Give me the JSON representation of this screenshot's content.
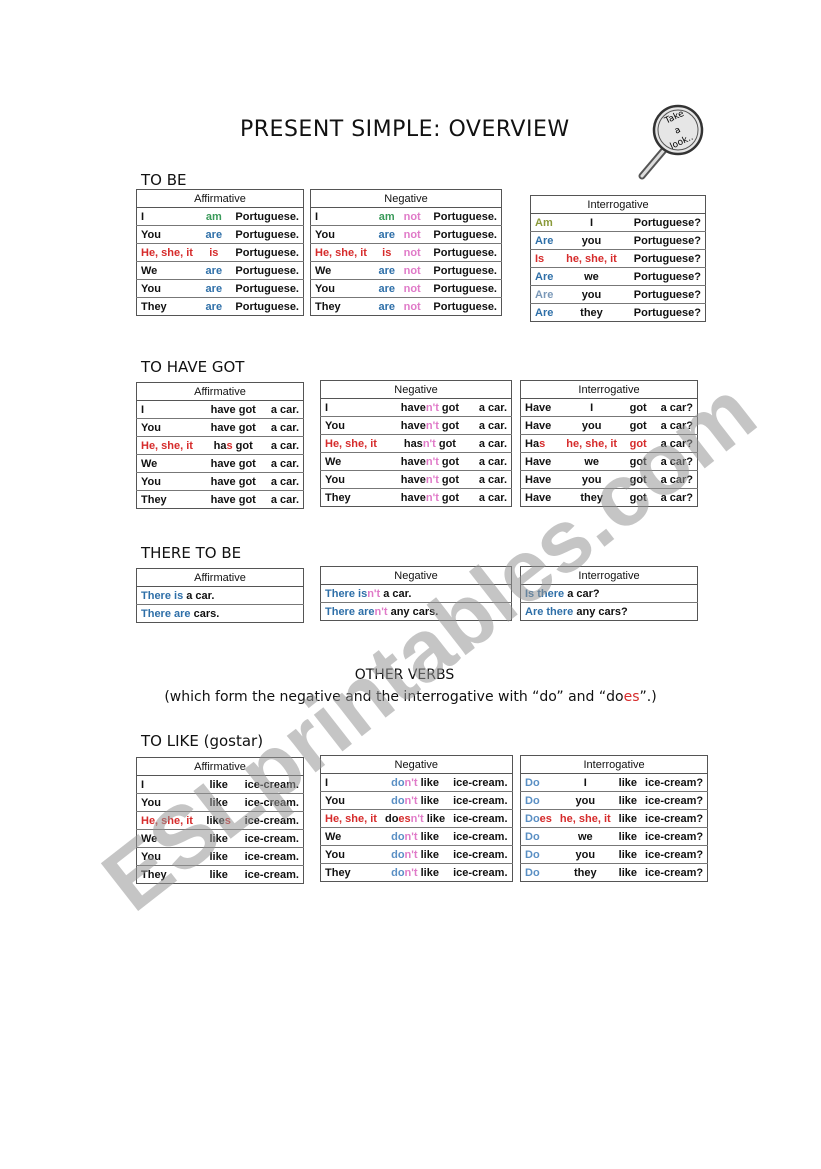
{
  "title": "PRESENT SIMPLE: OVERVIEW",
  "badge": {
    "line1": "Take",
    "line2": "a",
    "line3": "look..",
    "icon": "magnifying-glass-icon"
  },
  "watermark": "ESLprintables.com",
  "headers": {
    "affirmative": "Affirmative",
    "negative": "Negative",
    "interrogative": "Interrogative"
  },
  "to_be": {
    "title": "TO BE",
    "affirmative": [
      [
        "I",
        "am",
        "Portuguese."
      ],
      [
        "You",
        "are",
        "Portuguese."
      ],
      [
        "He, she, it",
        "is",
        "Portuguese."
      ],
      [
        "We",
        "are",
        "Portuguese."
      ],
      [
        "You",
        "are",
        "Portuguese."
      ],
      [
        "They",
        "are",
        "Portuguese."
      ]
    ],
    "negative": [
      [
        "I",
        "am",
        "not",
        "Portuguese."
      ],
      [
        "You",
        "are",
        "not",
        "Portuguese."
      ],
      [
        "He, she, it",
        "is",
        "not",
        "Portuguese."
      ],
      [
        "We",
        "are",
        "not",
        "Portuguese."
      ],
      [
        "You",
        "are",
        "not",
        "Portuguese."
      ],
      [
        "They",
        "are",
        "not",
        "Portuguese."
      ]
    ],
    "interrogative": [
      [
        "Am",
        "I",
        "Portuguese?"
      ],
      [
        "Are",
        "you",
        "Portuguese?"
      ],
      [
        "Is",
        "he, she, it",
        "Portuguese?"
      ],
      [
        "Are",
        "we",
        "Portuguese?"
      ],
      [
        "Are",
        "you",
        "Portuguese?"
      ],
      [
        "Are",
        "they",
        "Portuguese?"
      ]
    ]
  },
  "to_have_got": {
    "title": "TO HAVE GOT",
    "affirmative": [
      [
        "I",
        "have got",
        "a car."
      ],
      [
        "You",
        "have got",
        "a car."
      ],
      [
        "He, she, it",
        "ha",
        "s",
        " got",
        "a car."
      ],
      [
        "We",
        "have got",
        "a car."
      ],
      [
        "You",
        "have got",
        "a car."
      ],
      [
        "They",
        "have got",
        "a car."
      ]
    ],
    "negative": [
      [
        "I",
        "have",
        "n't",
        " got",
        "a car."
      ],
      [
        "You",
        "have",
        "n't",
        " got",
        "a car."
      ],
      [
        "He, she, it",
        "has",
        "n't",
        " got",
        "a car."
      ],
      [
        "We",
        "have",
        "n't",
        " got",
        "a car."
      ],
      [
        "You",
        "have",
        "n't",
        " got",
        "a car."
      ],
      [
        "They",
        "have",
        "n't",
        " got",
        "a car."
      ]
    ],
    "interrogative": [
      [
        "Have",
        "I",
        "got",
        "a car?"
      ],
      [
        "Have",
        "you",
        "got",
        "a car?"
      ],
      [
        "Ha",
        "s",
        "he, she, it",
        "got",
        "a car?"
      ],
      [
        "Have",
        "we",
        "got",
        "a car?"
      ],
      [
        "Have",
        "you",
        "got",
        "a car?"
      ],
      [
        "Have",
        "they",
        "got",
        "a car?"
      ]
    ]
  },
  "there_to_be": {
    "title": "THERE TO BE",
    "affirmative": [
      [
        "There is",
        " a car."
      ],
      [
        "There are",
        " cars."
      ]
    ],
    "negative": [
      [
        "There is",
        "n't",
        " a car."
      ],
      [
        "There are",
        "n't",
        " any cars."
      ]
    ],
    "interrogative": [
      [
        "Is there",
        " a car?"
      ],
      [
        "Are there",
        " any cars?"
      ]
    ]
  },
  "other_verbs": {
    "title": "OTHER VERBS",
    "subtitle_pre": "(which form the negative and the interrogative with “do” and “do",
    "subtitle_es": "es",
    "subtitle_post": "”.)"
  },
  "to_like": {
    "title": "TO  LIKE (gostar)",
    "affirmative": [
      [
        "I",
        "like",
        "",
        "ice-cream."
      ],
      [
        "You",
        "like",
        "",
        "ice-cream."
      ],
      [
        "He, she, it",
        "like",
        "s",
        "ice-cream."
      ],
      [
        "We",
        "like",
        "",
        "ice-cream."
      ],
      [
        "You",
        "like",
        "",
        "ice-cream."
      ],
      [
        "They",
        "like",
        "",
        "ice-cream."
      ]
    ],
    "negative": [
      [
        "I",
        "do",
        "n't",
        " like",
        "ice-cream."
      ],
      [
        "You",
        "do",
        "n't",
        " like",
        "ice-cream."
      ],
      [
        "He, she, it",
        "do",
        "es",
        "n't",
        " like",
        "ice-cream."
      ],
      [
        "We",
        "do",
        "n't",
        " like",
        "ice-cream."
      ],
      [
        "You",
        "do",
        "n't",
        " like",
        "ice-cream."
      ],
      [
        "They",
        "do",
        "n't",
        " like",
        "ice-cream."
      ]
    ],
    "interrogative": [
      [
        "Do",
        "I",
        "like",
        "ice-cream?"
      ],
      [
        "Do",
        "you",
        "like",
        "ice-cream?"
      ],
      [
        "Do",
        "es",
        "he, she, it",
        "like",
        "ice-cream?"
      ],
      [
        "Do",
        "we",
        "like",
        "ice-cream?"
      ],
      [
        "Do",
        "you",
        "like",
        "ice-cream?"
      ],
      [
        "Do",
        "they",
        "like",
        "ice-cream?"
      ]
    ]
  },
  "colors": {
    "third_person": "#d62b2b",
    "verb_blue": "#2e6fa8",
    "negation_pink": "#e07ac8",
    "am_green": "#3a9a5a"
  }
}
